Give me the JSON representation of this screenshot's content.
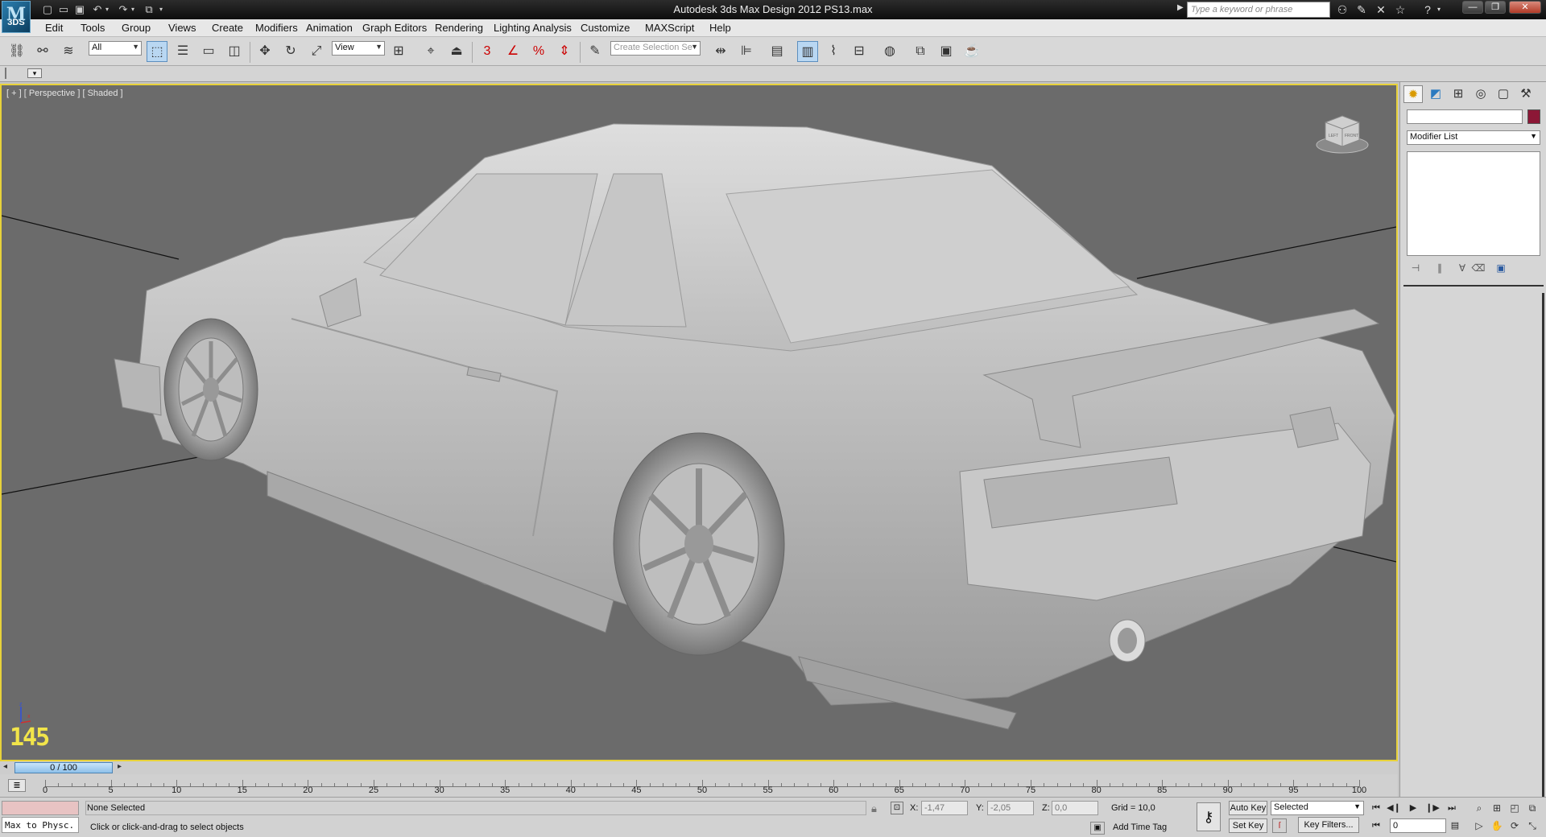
{
  "window": {
    "title": "Autodesk 3ds Max Design 2012     PS13.max",
    "logo_text": "3DS",
    "search_placeholder": "Type a keyword or phrase"
  },
  "menu": [
    "Edit",
    "Tools",
    "Group",
    "Views",
    "Create",
    "Modifiers",
    "Animation",
    "Graph Editors",
    "Rendering",
    "Lighting Analysis",
    "Customize",
    "MAXScript",
    "Help"
  ],
  "toolbar": {
    "selection_filter": "All",
    "ref_coord": "View",
    "named_selection_placeholder": "Create Selection Se",
    "snap_label": "3",
    "snap_percent_label": "%"
  },
  "viewport": {
    "label": "[ + ] [ Perspective ] [ Shaded ]",
    "fps": "145",
    "viewcube_left": "LEFT",
    "viewcube_front": "FRONT",
    "axis_z": "z",
    "axis_x": "x"
  },
  "command_panel": {
    "modifier_list": "Modifier List",
    "object_color": "#8c1736"
  },
  "timeline": {
    "frame_display": "0 / 100",
    "ticks": [
      0,
      5,
      10,
      15,
      20,
      25,
      30,
      35,
      40,
      45,
      50,
      55,
      60,
      65,
      70,
      75,
      80,
      85,
      90,
      95,
      100
    ]
  },
  "status": {
    "script_listener": "Max to Physc.",
    "selection": "None Selected",
    "prompt": "Click or click-and-drag to select objects",
    "x_label": "X:",
    "x_value": "-1,47",
    "y_label": "Y:",
    "y_value": "-2,05",
    "z_label": "Z:",
    "z_value": "0,0",
    "grid": "Grid = 10,0",
    "add_time_tag": "Add Time Tag",
    "auto_key": "Auto Key",
    "set_key": "Set Key",
    "key_mode": "Selected",
    "key_filters": "Key Filters...",
    "current_frame": "0"
  }
}
